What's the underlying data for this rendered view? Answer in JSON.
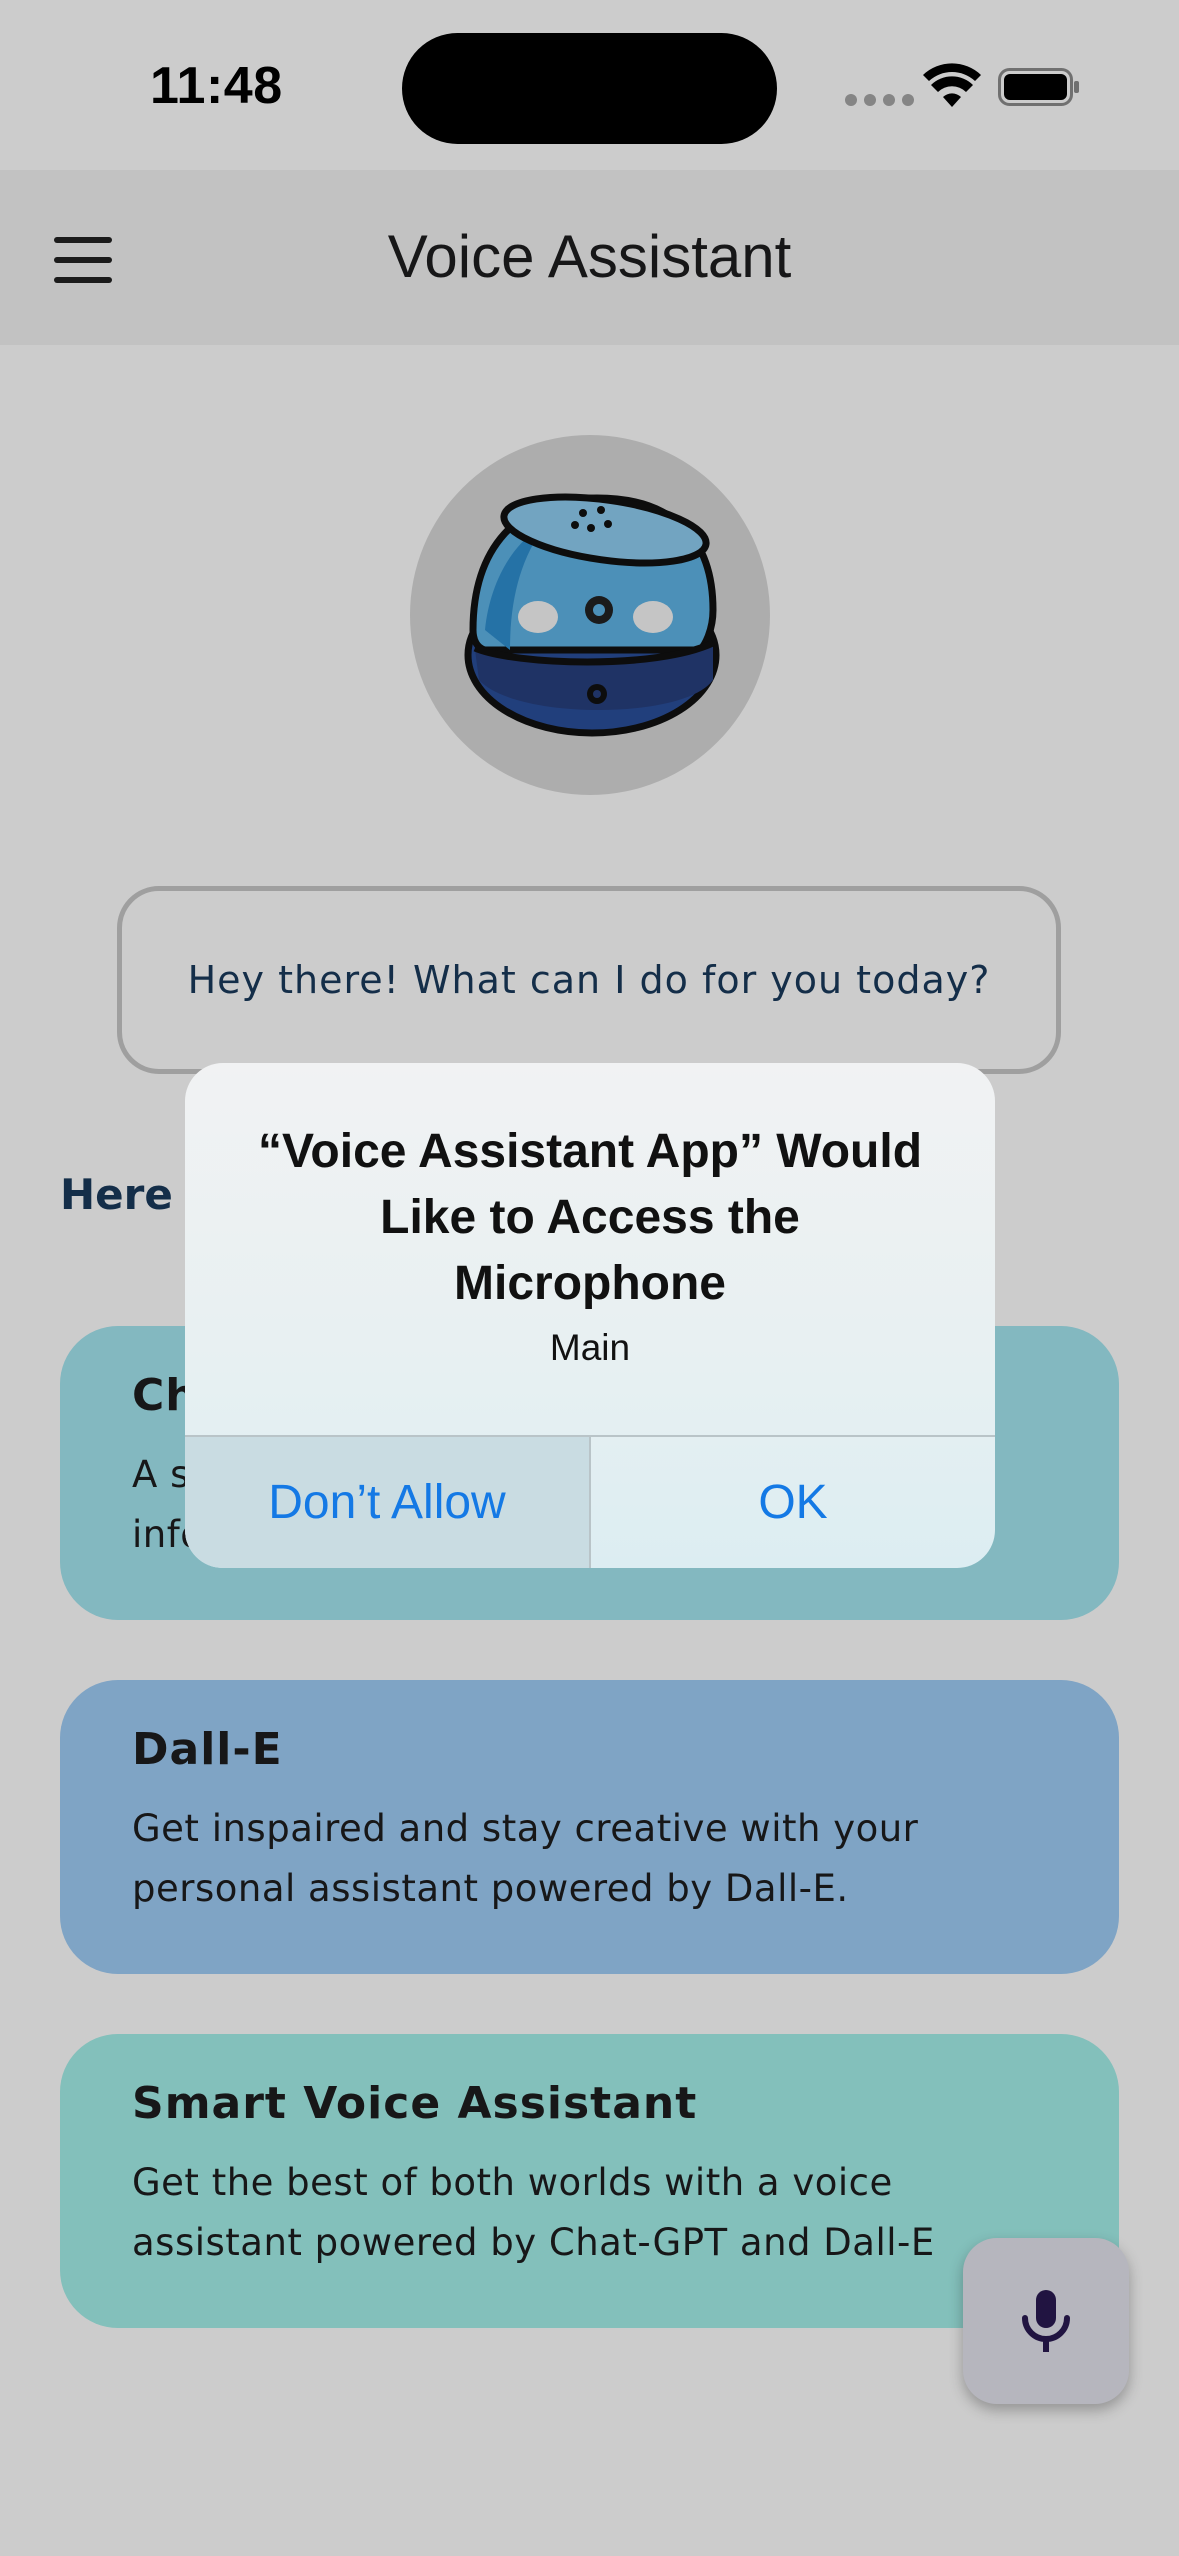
{
  "status_bar": {
    "time": "11:48"
  },
  "app_bar": {
    "title": "Voice Assistant",
    "menu_icon": "hamburger-menu-icon"
  },
  "assistant": {
    "avatar_icon": "robot-speaker-icon"
  },
  "greeting": {
    "text": "Hey there! What can I do for you today?"
  },
  "features": {
    "heading": "Here",
    "cards": [
      {
        "title": "Ch",
        "description_line1": "A s",
        "description_line2": "info",
        "color": "#a4e6f0"
      },
      {
        "title": "Dall-E",
        "description_line1": "Get inspaired and stay creative with your",
        "description_line2": "personal assistant powered by Dall-E.",
        "color": "#9fcdf7"
      },
      {
        "title": "Smart Voice Assistant",
        "description_line1": "Get the best of both worlds with a voice",
        "description_line2": "assistant powered by Chat-GPT and Dall-E",
        "color": "#a4f0ea"
      }
    ]
  },
  "fab": {
    "icon": "microphone-icon"
  },
  "alert": {
    "title_line1": "“Voice Assistant App” Would",
    "title_line2": "Like to Access the",
    "title_line3": "Microphone",
    "message": "Main",
    "deny_label": "Don’t Allow",
    "ok_label": "OK",
    "accent_color": "#1479e5"
  }
}
